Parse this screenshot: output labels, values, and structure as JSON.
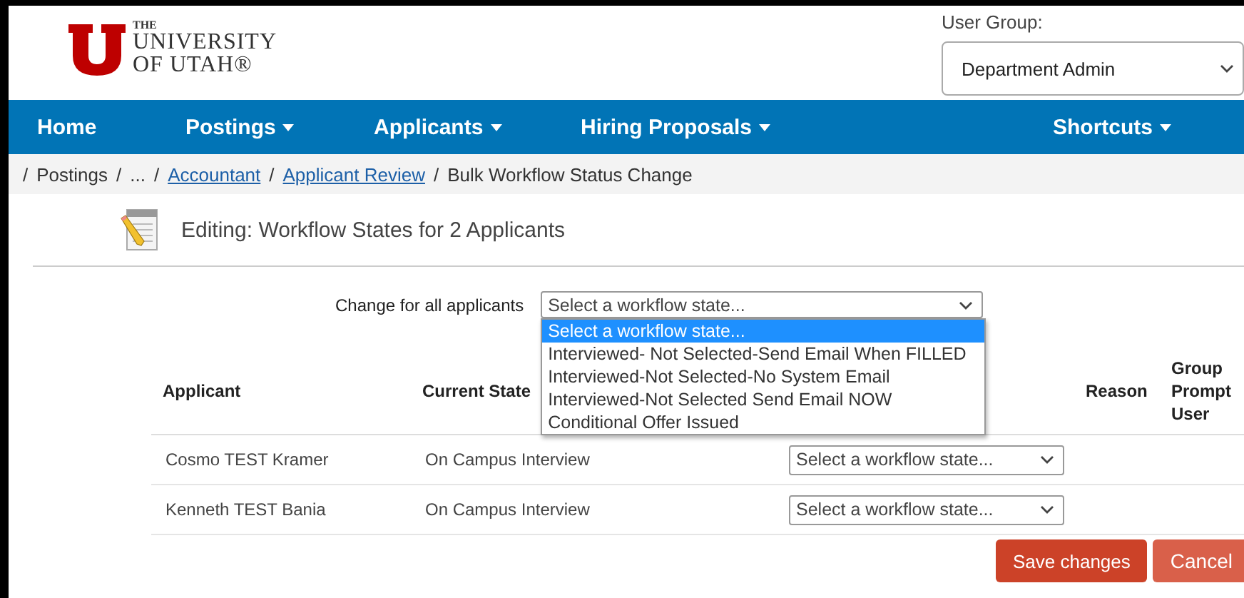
{
  "header": {
    "logo_text": [
      "THE",
      "UNIVERSITY",
      "OF UTAH®"
    ],
    "user_group": {
      "label": "User Group:",
      "value": "Department Admin"
    }
  },
  "nav": [
    {
      "label": "Home",
      "dropdown": false
    },
    {
      "label": "Postings",
      "dropdown": true
    },
    {
      "label": "Applicants",
      "dropdown": true
    },
    {
      "label": "Hiring Proposals",
      "dropdown": true
    },
    {
      "label": "Shortcuts",
      "dropdown": true
    }
  ],
  "breadcrumb": [
    {
      "sep": "/",
      "label": "Postings",
      "link": false
    },
    {
      "sep": "/",
      "label": "...",
      "link": false
    },
    {
      "sep": "/",
      "label": "Accountant",
      "link": true
    },
    {
      "sep": "/",
      "label": "Applicant Review",
      "link": true
    },
    {
      "sep": "/",
      "label": "Bulk Workflow Status Change",
      "link": false
    }
  ],
  "heading": "Editing: Workflow States for 2 Applicants",
  "change_all": {
    "label": "Change for all applicants",
    "value": "Select a workflow state...",
    "options": [
      {
        "label": "Select a workflow state...",
        "selected": true
      },
      {
        "label": "Interviewed- Not Selected-Send Email When FILLED",
        "selected": false
      },
      {
        "label": "Interviewed-Not Selected-No System Email",
        "selected": false
      },
      {
        "label": "Interviewed-Not Selected Send Email NOW",
        "selected": false
      },
      {
        "label": "Conditional Offer Issued",
        "selected": false
      }
    ]
  },
  "table": {
    "columns": [
      {
        "lines": [
          "Applicant"
        ]
      },
      {
        "lines": [
          "Current State"
        ]
      },
      {
        "lines": [
          "Reason"
        ]
      },
      {
        "lines": [
          "Group",
          "Prompt",
          "User"
        ]
      }
    ],
    "rows": [
      {
        "applicant": "Cosmo TEST Kramer",
        "current_state": "On Campus Interview",
        "new_state": "Select a workflow state..."
      },
      {
        "applicant": "Kenneth TEST Bania",
        "current_state": "On Campus Interview",
        "new_state": "Select a workflow state..."
      }
    ]
  },
  "buttons": [
    {
      "label": "Save changes",
      "kind": "primary"
    },
    {
      "label": "Cancel",
      "kind": "secondary"
    }
  ]
}
